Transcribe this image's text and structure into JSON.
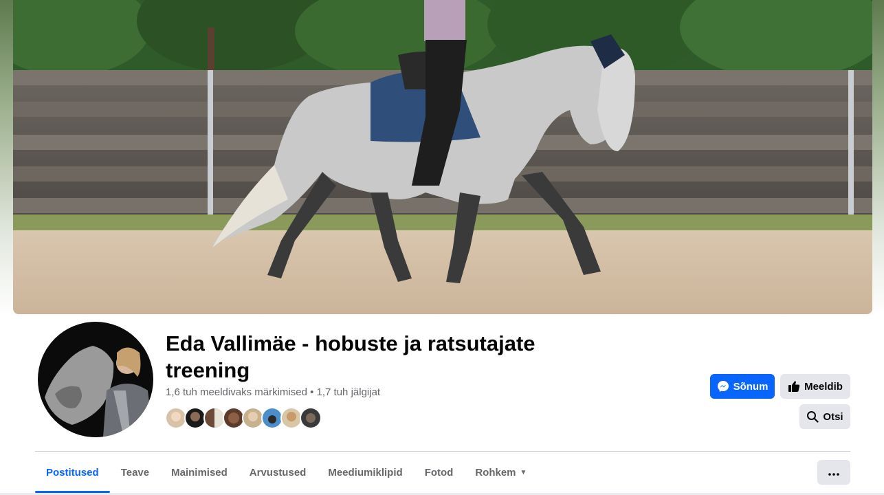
{
  "cover": {
    "image": "horse-rider-cover-photo"
  },
  "profile": {
    "image": "profile-photo-woman-with-horse"
  },
  "page_title": "Eda Vallimäe - hobuste ja ratsutajate treening",
  "stats": {
    "likes": "1,6 tuh meeldivaks märkimised",
    "separator": "•",
    "followers": "1,7 tuh jälgijat"
  },
  "follower_avatars": [
    "follower-1",
    "follower-2",
    "follower-3",
    "follower-4",
    "follower-5",
    "follower-6",
    "follower-7",
    "follower-8"
  ],
  "actions": {
    "message_label": "Sõnum",
    "like_label": "Meeldib",
    "search_label": "Otsi"
  },
  "tabs": [
    {
      "label": "Postitused",
      "active": true
    },
    {
      "label": "Teave"
    },
    {
      "label": "Mainimised"
    },
    {
      "label": "Arvustused"
    },
    {
      "label": "Meediumiklipid"
    },
    {
      "label": "Fotod"
    },
    {
      "label": "Rohkem"
    }
  ],
  "colors": {
    "accent": "#0866ff",
    "secondary_button": "#e4e6eb",
    "text_primary": "#050505",
    "text_secondary": "#65676b"
  },
  "icons": {
    "message": "messenger-icon",
    "like": "thumbs-up-icon",
    "search": "search-icon",
    "more": "ellipsis-icon",
    "rohkem": "caret-down-icon"
  }
}
